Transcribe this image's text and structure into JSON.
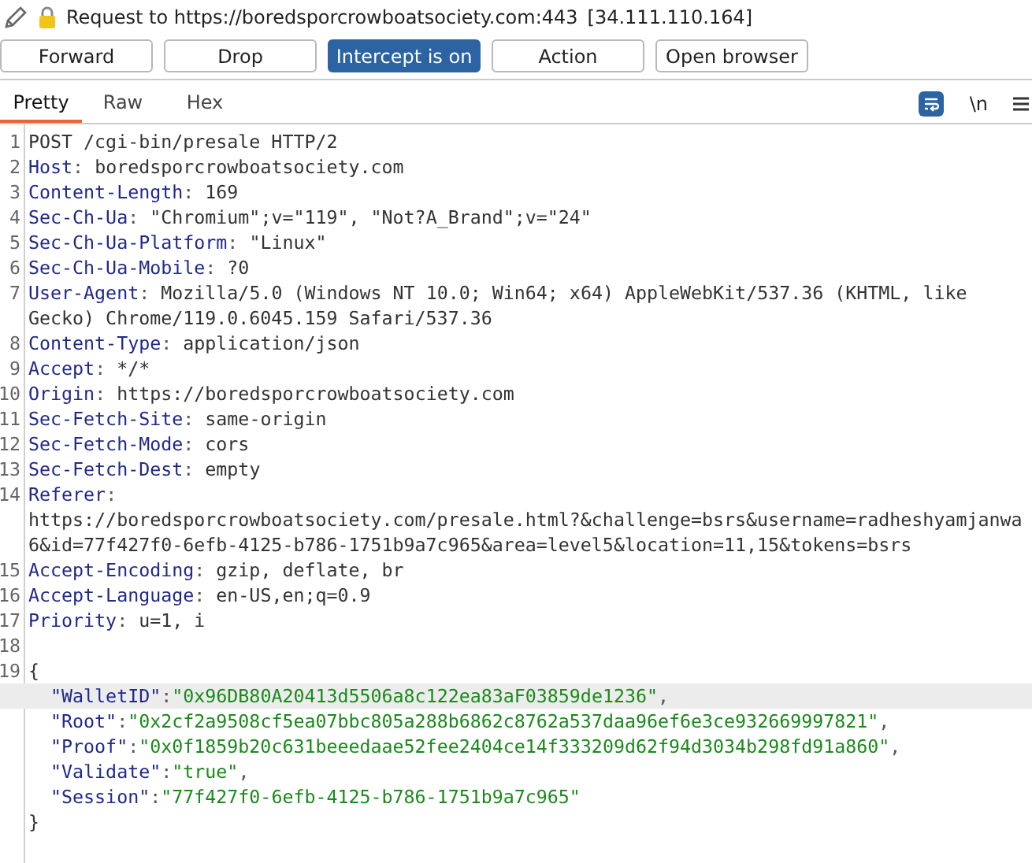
{
  "header": {
    "title": "Request to https://boredsporcrowboatsociety.com:443",
    "address": "[34.111.110.164]"
  },
  "buttons": [
    {
      "label": "Forward",
      "active": false
    },
    {
      "label": "Drop",
      "active": false
    },
    {
      "label": "Intercept is on",
      "active": true
    },
    {
      "label": "Action",
      "active": false
    },
    {
      "label": "Open browser",
      "active": false
    }
  ],
  "tabs": [
    {
      "label": "Pretty",
      "selected": true
    },
    {
      "label": "Raw",
      "selected": false
    },
    {
      "label": "Hex",
      "selected": false
    }
  ],
  "tools": [
    {
      "kind": "wrap",
      "active": true
    },
    {
      "kind": "newline",
      "label": "\\n",
      "active": false
    },
    {
      "kind": "menu"
    }
  ],
  "lines": [
    {
      "number": "1",
      "kind": "plain",
      "text": "POST /cgi-bin/presale HTTP/2"
    },
    {
      "number": "2",
      "kind": "header",
      "name": "Host",
      "separator": ":",
      "value": "boredsporcrowboatsociety.com"
    },
    {
      "number": "3",
      "kind": "header",
      "name": "Content-Length",
      "separator": ":",
      "value": "169"
    },
    {
      "number": "4",
      "kind": "header",
      "name": "Sec-Ch-Ua",
      "separator": ":",
      "value": "\"Chromium\";v=\"119\", \"Not?A_Brand\";v=\"24\""
    },
    {
      "number": "5",
      "kind": "header",
      "name": "Sec-Ch-Ua-Platform",
      "separator": ":",
      "value": "\"Linux\""
    },
    {
      "number": "6",
      "kind": "header",
      "name": "Sec-Ch-Ua-Mobile",
      "separator": ":",
      "value": "?0"
    },
    {
      "number": "7",
      "kind": "header",
      "break_anywhere": false,
      "name": "User-Agent",
      "separator": ":",
      "value": "Mozilla/5.0 (Windows NT 10.0; Win64; x64) AppleWebKit/537.36 (KHTML, like Gecko) Chrome/119.0.6045.159 Safari/537.36"
    },
    {
      "number": "8",
      "kind": "header",
      "name": "Content-Type",
      "separator": ":",
      "value": "application/json"
    },
    {
      "number": "9",
      "kind": "header",
      "name": "Accept",
      "separator": ":",
      "value": "*/*"
    },
    {
      "number": "10",
      "kind": "header",
      "name": "Origin",
      "separator": ":",
      "value": "https://boredsporcrowboatsociety.com"
    },
    {
      "number": "11",
      "kind": "header",
      "name": "Sec-Fetch-Site",
      "separator": ":",
      "value": "same-origin"
    },
    {
      "number": "12",
      "kind": "header",
      "name": "Sec-Fetch-Mode",
      "separator": ":",
      "value": "cors"
    },
    {
      "number": "13",
      "kind": "header",
      "name": "Sec-Fetch-Dest",
      "separator": ":",
      "value": "empty"
    },
    {
      "number": "14",
      "kind": "header",
      "break_anywhere": true,
      "name": "Referer",
      "separator": ":",
      "value": "https://boredsporcrowboatsociety.com/presale.html?&challenge=bsrs&username=radheshyamjanwa6&id=77f427f0-6efb-4125-b786-1751b9a7c965&area=level5&location=11,15&tokens=bsrs"
    },
    {
      "number": "15",
      "kind": "header",
      "name": "Accept-Encoding",
      "separator": ":",
      "value": "gzip, deflate, br"
    },
    {
      "number": "16",
      "kind": "header",
      "name": "Accept-Language",
      "separator": ":",
      "value": "en-US,en;q=0.9"
    },
    {
      "number": "17",
      "kind": "header",
      "name": "Priority",
      "separator": ":",
      "value": "u=1, i"
    },
    {
      "number": "18",
      "kind": "blank"
    },
    {
      "number": "19",
      "kind": "json",
      "open": "{",
      "close": "}",
      "fields": [
        {
          "key": "\"WalletID\"",
          "colon": ":",
          "value": "\"0x96DB80A20413d5506a8c122ea83aF03859de1236\"",
          "comma": ",",
          "highlighted": true
        },
        {
          "key": "\"Root\"",
          "colon": ":",
          "value": "\"0x2cf2a9508cf5ea07bbc805a288b6862c8762a537daa96ef6e3ce932669997821\"",
          "comma": ",",
          "highlighted": false
        },
        {
          "key": "\"Proof\"",
          "colon": ":",
          "value": "\"0x0f1859b20c631beeedaae52fee2404ce14f333209d62f94d3034b298fd91a860\"",
          "comma": ",",
          "highlighted": false
        },
        {
          "key": "\"Validate\"",
          "colon": ":",
          "value": "\"true\"",
          "comma": ",",
          "highlighted": false
        },
        {
          "key": "\"Session\"",
          "colon": ":",
          "value": "\"77f427f0-6efb-4125-b786-1751b9a7c965\"",
          "highlighted": false
        }
      ]
    }
  ]
}
